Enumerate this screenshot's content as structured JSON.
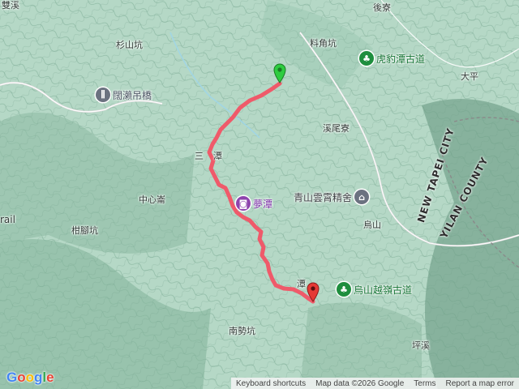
{
  "place_labels": [
    {
      "text": "雙溪"
    },
    {
      "text": "後寮"
    },
    {
      "text": "杉山坑"
    },
    {
      "text": "料角坑"
    },
    {
      "text": "大平"
    },
    {
      "text": "溪尾寮"
    },
    {
      "text": "三"
    },
    {
      "text": "潭"
    },
    {
      "text": "中心崙"
    },
    {
      "text": "烏山"
    },
    {
      "text": "柑腳坑"
    },
    {
      "text": "潭"
    },
    {
      "text": "南勢坑"
    },
    {
      "text": "坪溪"
    },
    {
      "text": "rail"
    }
  ],
  "pois": [
    {
      "name": "闊瀨吊橋",
      "icon": "bridge-icon",
      "color": "#6b7280",
      "text_color": "#4b5563"
    },
    {
      "name": "虎豹潭古道",
      "icon": "park-icon",
      "color": "#1e8e3e",
      "text_color": "#137333"
    },
    {
      "name": "夢潭",
      "icon": "camera-icon",
      "color": "#8e44ad",
      "text_color": "#7b2fa6"
    },
    {
      "name": "青山雲霄精舍",
      "icon": "temple-icon",
      "color": "#6b7280",
      "text_color": "#3c4043"
    },
    {
      "name": "烏山越嶺古道",
      "icon": "park-icon",
      "color": "#1e8e3e",
      "text_color": "#137333"
    }
  ],
  "county_labels": [
    "NEW TAPEI CITY",
    "YILAN COUNTY"
  ],
  "route": {
    "color": "#ef5a6a",
    "start_marker": "start-pin-icon",
    "start_color": "#2ecc40",
    "end_marker": "end-pin-icon",
    "end_color": "#e53935"
  },
  "google_logo": "Google",
  "attribution": {
    "keyboard": "Keyboard shortcuts",
    "mapdata": "Map data ©2026 Google",
    "terms": "Terms",
    "report": "Report a map error"
  }
}
